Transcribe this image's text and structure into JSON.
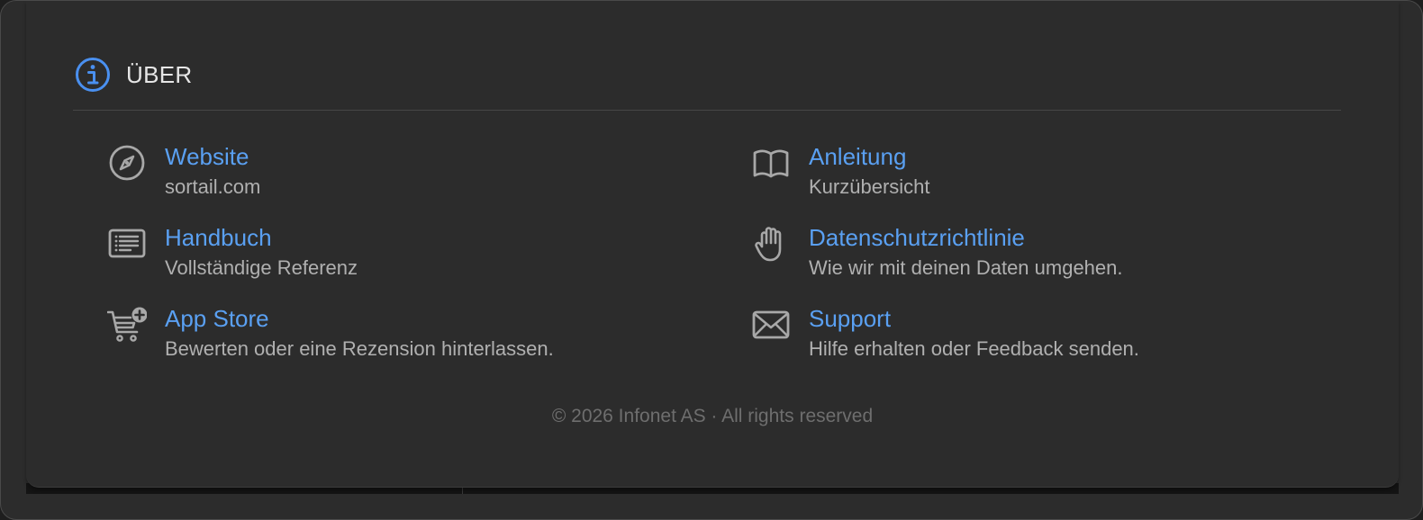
{
  "section": {
    "title": "ÜBER",
    "icon": "info-icon",
    "accent_color": "#4a90f0"
  },
  "links": [
    {
      "id": "website",
      "icon": "compass-icon",
      "label": "Website",
      "sub": "sortail.com"
    },
    {
      "id": "guide",
      "icon": "book-icon",
      "label": "Anleitung",
      "sub": "Kurzübersicht"
    },
    {
      "id": "manual",
      "icon": "document-list-icon",
      "label": "Handbuch",
      "sub": "Vollständige Referenz"
    },
    {
      "id": "privacy",
      "icon": "hand-raised-icon",
      "label": "Datenschutzrichtlinie",
      "sub": "Wie wir mit deinen Daten umgehen."
    },
    {
      "id": "appstore",
      "icon": "cart-plus-icon",
      "label": "App Store",
      "sub": "Bewerten oder eine Rezension hinterlassen."
    },
    {
      "id": "support",
      "icon": "envelope-icon",
      "label": "Support",
      "sub": "Hilfe erhalten oder Feedback senden."
    }
  ],
  "footer": {
    "text": "© 2026 Infonet AS · All rights reserved"
  },
  "colors": {
    "link": "#5aa0f2",
    "subtext": "#b0b0b0",
    "icon": "#a8a8a8",
    "background": "#2c2c2c"
  }
}
